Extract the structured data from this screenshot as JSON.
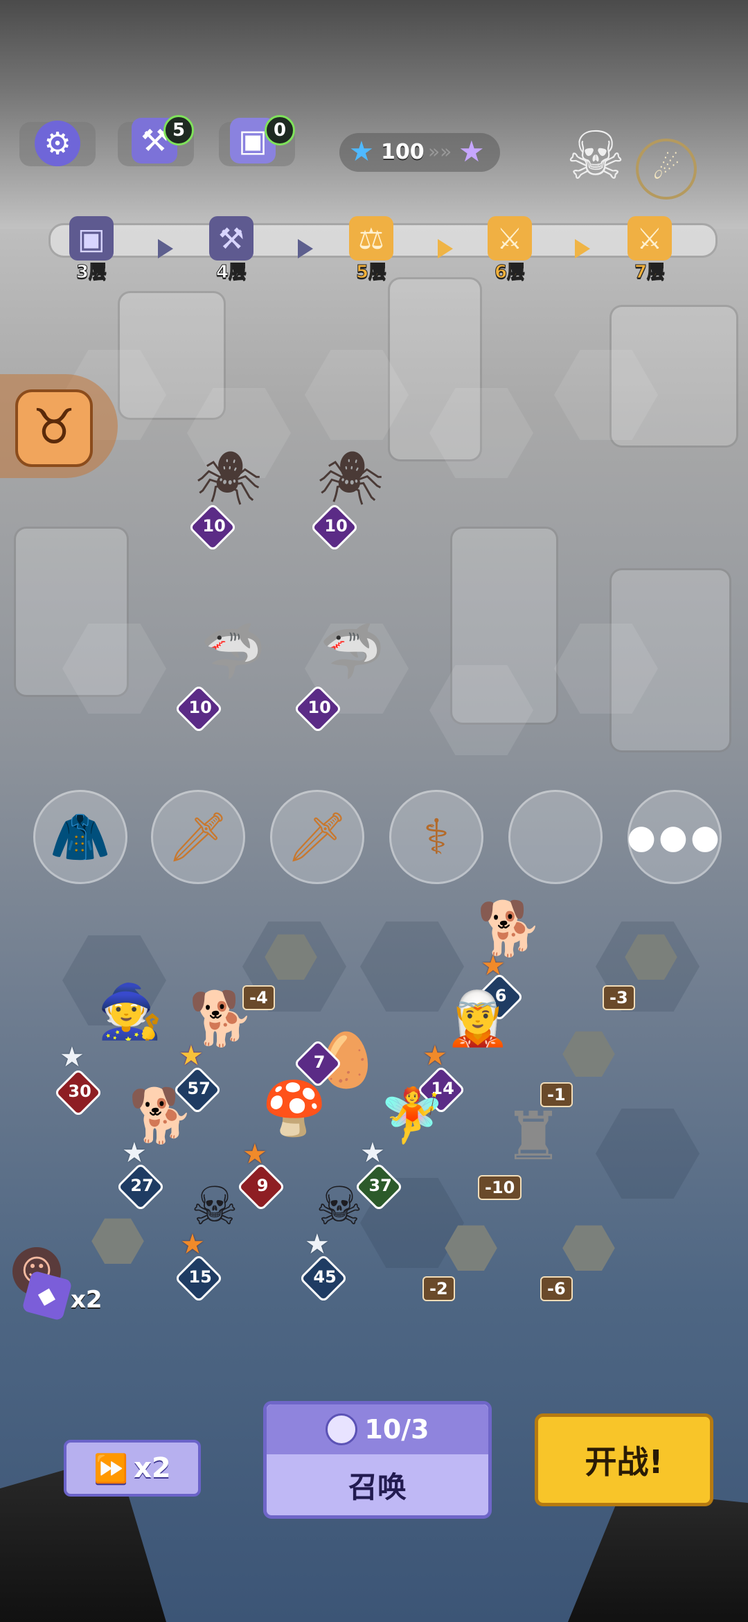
{
  "hud": {
    "anvil_count": "5",
    "chest_count": "0",
    "star_value": "100"
  },
  "floors": [
    {
      "label": "3层",
      "icon": "chest-icon"
    },
    {
      "label": "4层",
      "icon": "anvil-icon"
    },
    {
      "label": "5层",
      "icon": "scales-icon",
      "active": true
    },
    {
      "label": "6层",
      "icon": "crossed-swords-icon"
    },
    {
      "label": "7层",
      "icon": "crossed-swords-icon"
    }
  ],
  "enemies": [
    {
      "name": "spider",
      "level": "10"
    },
    {
      "name": "spider",
      "level": "10"
    },
    {
      "name": "shark",
      "level": "10"
    },
    {
      "name": "shark",
      "level": "10"
    }
  ],
  "equipment": [
    "armor-icon",
    "sword-icon",
    "sword-icon",
    "staff-icon",
    "empty-slot",
    "more-icon"
  ],
  "units": [
    {
      "name": "corgi-rider",
      "level": "6",
      "star": "gold"
    },
    {
      "name": "staff-boy",
      "level": "30",
      "star": "silver"
    },
    {
      "name": "corgi-mage",
      "level": "57",
      "star": "gold"
    },
    {
      "name": "witch-archer",
      "level": "14",
      "star": "orange"
    },
    {
      "name": "purple-egg",
      "level": "7"
    },
    {
      "name": "corgi-mage-2",
      "level": "27",
      "star": "silver"
    },
    {
      "name": "mushroom-priest",
      "level": "9",
      "star": "orange"
    },
    {
      "name": "leaf-girl",
      "level": "37",
      "star": "silver"
    },
    {
      "name": "reaper",
      "level": "15",
      "star": "orange"
    },
    {
      "name": "reaper-2",
      "level": "45",
      "star": "silver"
    }
  ],
  "obstacles": [
    "-4",
    "-3",
    "-1",
    "-10",
    "-2",
    "-6"
  ],
  "side": {
    "multiplier": "x2"
  },
  "controls": {
    "speed": "x2",
    "summon_cost": "10/3",
    "summon_label": "召唤",
    "fight_label": "开战!"
  }
}
